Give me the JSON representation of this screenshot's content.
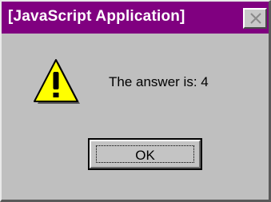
{
  "window": {
    "title": "[JavaScript Application]",
    "titlebar_color": "#800080",
    "close_icon": "close-x-icon"
  },
  "dialog": {
    "icon": "warning-icon",
    "message": "The answer is: 4",
    "ok_label": "OK"
  }
}
